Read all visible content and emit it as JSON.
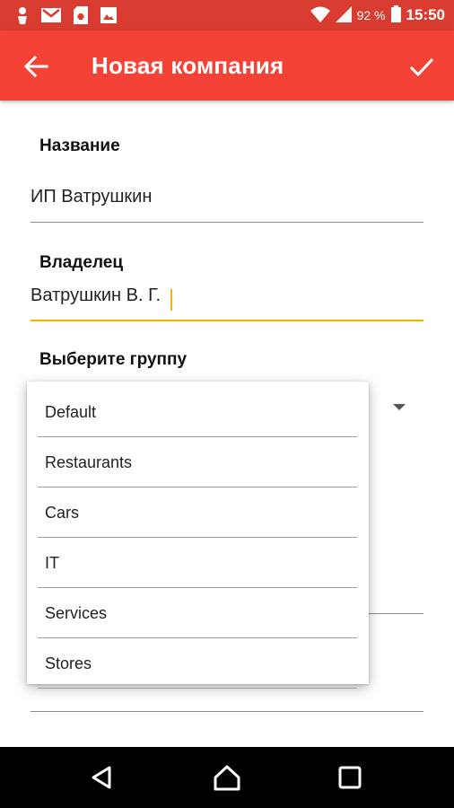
{
  "status_bar": {
    "battery": "92 %",
    "time": "15:50",
    "icons": [
      "person-pin-icon",
      "gmail-icon",
      "sim-card-icon",
      "image-icon",
      "wifi-icon",
      "signal-icon",
      "battery-icon"
    ]
  },
  "toolbar": {
    "title": "Новая компания",
    "back_icon": "arrow-back-icon",
    "save_icon": "checkmark-icon"
  },
  "form": {
    "name_label": "Название",
    "name_value": "ИП Ватрушкин",
    "owner_label": "Владелец",
    "owner_value": "Ватрушкин В. Г.",
    "group_label": "Выберите группу",
    "group_options": [
      "Default",
      "Restaurants",
      "Cars",
      "IT",
      "Services",
      "Stores"
    ]
  },
  "colors": {
    "primary": "#f44336",
    "status_bar": "#d83b2f",
    "accent": "#f5b400"
  },
  "nav_bar": {
    "icons": [
      "back-triangle-icon",
      "home-circle-icon",
      "recents-square-icon"
    ]
  }
}
